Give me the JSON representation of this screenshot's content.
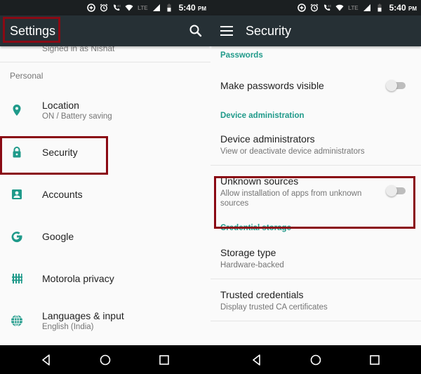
{
  "status_bar": {
    "icons": [
      "data-saver-icon",
      "alarm-icon",
      "volte-call-icon",
      "wifi-icon",
      "lte-signal-icon",
      "signal-icon",
      "battery-icon"
    ],
    "network_label": "LTE",
    "call_badge": "4G",
    "time": "5:40",
    "ampm": "PM"
  },
  "left": {
    "appbar": {
      "title": "Settings",
      "search_icon": "search-icon"
    },
    "account_summary": "Signed in as Nishat",
    "category": "Personal",
    "items": [
      {
        "title": "Location",
        "summary": "ON / Battery saving",
        "icon": "location-pin-icon"
      },
      {
        "title": "Security",
        "summary": "",
        "icon": "lock-icon"
      },
      {
        "title": "Accounts",
        "summary": "",
        "icon": "account-box-icon"
      },
      {
        "title": "Google",
        "summary": "",
        "icon": "google-g-icon"
      },
      {
        "title": "Motorola privacy",
        "summary": "",
        "icon": "motorola-privacy-icon"
      },
      {
        "title": "Languages & input",
        "summary": "English (India)",
        "icon": "globe-icon"
      }
    ]
  },
  "right": {
    "appbar": {
      "title": "Security",
      "menu_icon": "hamburger-menu-icon"
    },
    "sections": [
      {
        "header": "Passwords",
        "items": [
          {
            "title": "Make passwords visible",
            "summary": "",
            "toggle": false
          }
        ]
      },
      {
        "header": "Device administration",
        "items": [
          {
            "title": "Device administrators",
            "summary": "View or deactivate device administrators"
          },
          {
            "title": "Unknown sources",
            "summary": "Allow installation of apps from unknown sources",
            "toggle": false
          }
        ]
      },
      {
        "header": "Credential storage",
        "items": [
          {
            "title": "Storage type",
            "summary": "Hardware-backed"
          },
          {
            "title": "Trusted credentials",
            "summary": "Display trusted CA certificates"
          }
        ]
      }
    ]
  },
  "navbar": {
    "back": "back-icon",
    "home": "home-icon",
    "recents": "recents-icon"
  },
  "colors": {
    "accent": "#1f9a8a",
    "appbar": "#263035",
    "statusbar": "#1b1f21",
    "highlight": "#8a0a14",
    "background": "#fafafa"
  }
}
